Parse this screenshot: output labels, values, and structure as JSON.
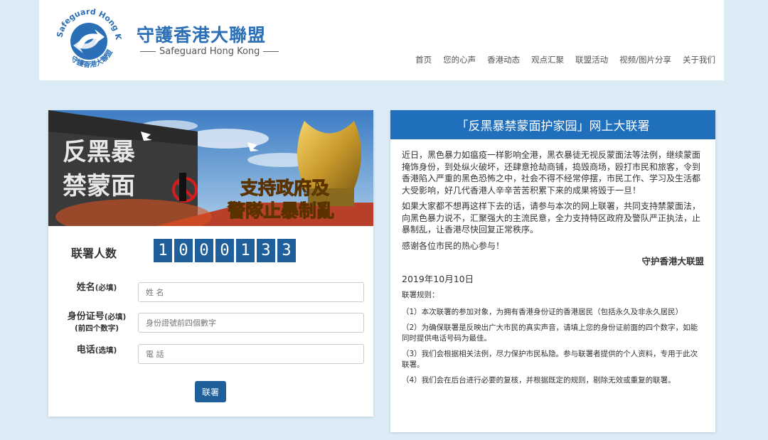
{
  "header": {
    "logo_text_top": "Safeguard Hong Kong",
    "logo_text_bottom": "守護香港大聯盟",
    "title": "守護香港大聯盟",
    "subtitle": "Safeguard Hong Kong",
    "nav": [
      "首页",
      "您的心声",
      "香港动态",
      "观点汇聚",
      "联盟活动",
      "视频/图片分享",
      "关于我们"
    ]
  },
  "banner": {
    "wall_line1": "反黑暴",
    "wall_line2": "禁蒙面",
    "slogan_line1": "支持政府及",
    "slogan_line2": "警隊止暴制亂"
  },
  "counter": {
    "label": "联署人数",
    "digits": [
      "1",
      "0",
      "0",
      "0",
      "1",
      "3",
      "3"
    ]
  },
  "form": {
    "name_label": "姓名",
    "name_note": "(必填)",
    "name_placeholder": "姓 名",
    "id_label": "身份证号",
    "id_note": "(必填)",
    "id_note2": "(前四个数字)",
    "id_placeholder": "身份證號前四個數字",
    "phone_label": "电话",
    "phone_note": "(选填)",
    "phone_placeholder": "電 話",
    "submit": "联署"
  },
  "panel": {
    "title": "「反黑暴禁蒙面护家园」网上大联署",
    "para1": "近日，黑色暴力如瘟疫一样影响全港，黑衣暴徒无视反蒙面法等法例，继续蒙面掩饰身份，到处纵火破坏，还肆意抢劫商铺，捣毁商场，殴打市民和旅客，令到香港陷入严重的黑色恐怖之中，社会不得不经常停摆，市民工作、学习及生活都大受影响，好几代香港人辛辛苦苦积累下来的成果将毁于一旦！",
    "para2": "如果大家都不想再这样下去的话，请参与本次的网上联署，共同支持禁蒙面法，向黑色暴力说不，汇聚强大的主流民意，全力支持特区政府及警队严正执法，止暴制乱，让香港尽快回复正常秩序。",
    "para3": "感谢各位市民的热心参与！",
    "signature": "守护香港大联盟",
    "date": "2019年10月10日",
    "rules_title": "联署规则：",
    "rules": [
      "（1）本次联署的参加对象，为拥有香港身份证的香港居民（包括永久及非永久居民）",
      "（2）为确保联署是反映出广大市民的真实声音，请填上您的身份证前面的四个数字，如能同时提供电话号码为最佳。",
      "（3）我们会根据相关法例，尽力保护市民私隐。参与联署者提供的个人资料，专用于此次联署。",
      "（4）我们会在后台进行必要的复核，并根据既定的规则，剔除无效或重复的联署。"
    ]
  },
  "colors": {
    "primary": "#1f5f9c",
    "panel_header": "#1f6fbd",
    "background": "#dcecf6",
    "brand": "#2b6fb6"
  }
}
